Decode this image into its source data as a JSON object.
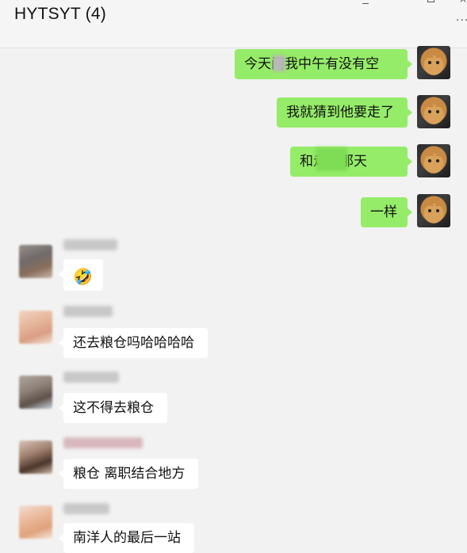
{
  "header": {
    "title": "HYTSYT (4)",
    "more_glyph": "···"
  },
  "messages": [
    {
      "side": "right",
      "text": "今天问我中午有没有空",
      "avatar": "cat"
    },
    {
      "side": "right",
      "text": "我就猜到他要走了",
      "avatar": "cat"
    },
    {
      "side": "right",
      "text": "和走的那天",
      "avatar": "cat"
    },
    {
      "side": "right",
      "text": "一样",
      "avatar": "cat"
    },
    {
      "side": "left",
      "sender": "",
      "emoji": "🤣",
      "emoji_name": "rofl-emoji"
    },
    {
      "side": "left",
      "sender": "",
      "text": "还去粮仓吗哈哈哈哈"
    },
    {
      "side": "left",
      "sender": "",
      "text": "这不得去粮仓"
    },
    {
      "side": "left",
      "sender": "",
      "text": "粮仓 离职结合地方"
    },
    {
      "side": "left",
      "sender": "",
      "text": "南洋人的最后一站"
    }
  ],
  "icons": {
    "minimize": "minimize-icon",
    "maximize": "maximize-icon",
    "close": "close-icon",
    "more": "more-icon"
  },
  "colors": {
    "self_bubble": "#95ec69",
    "other_bubble": "#ffffff",
    "background": "#f2f2f2"
  }
}
